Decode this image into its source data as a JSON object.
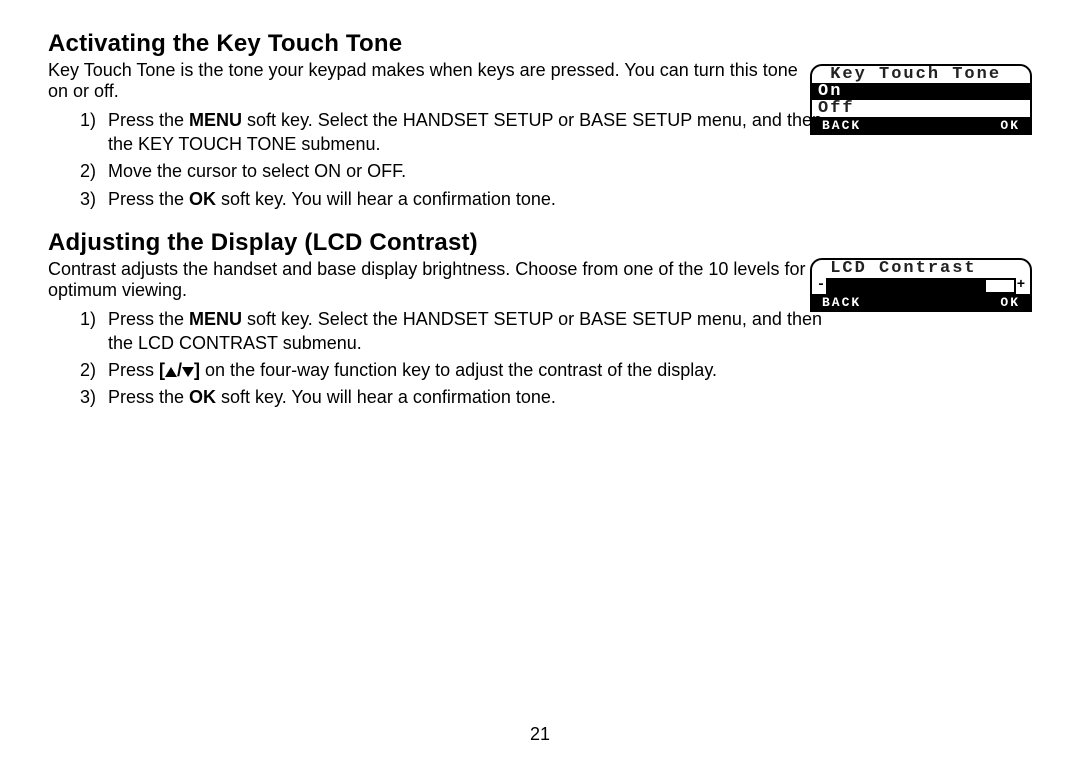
{
  "page_number": "21",
  "section1": {
    "heading": "Activating the Key Touch Tone",
    "intro": "Key Touch Tone is the tone your keypad makes when keys are pressed. You can turn this tone on or off.",
    "steps": {
      "s1a": "Press the ",
      "s1b": "MENU",
      "s1c": " soft key. Select the HANDSET SETUP or BASE SETUP menu, and then the KEY TOUCH TONE submenu.",
      "s2": "Move the cursor to select ON or OFF.",
      "s3a": "Press the ",
      "s3b": "OK",
      "s3c": " soft key. You will hear a confirmation tone."
    },
    "lcd": {
      "title": " Key Touch Tone",
      "option_on": "On",
      "option_off": "Off",
      "sk_back": "BACK",
      "sk_ok": "OK"
    }
  },
  "section2": {
    "heading": "Adjusting the Display (LCD Contrast)",
    "intro": "Contrast adjusts the handset and base display brightness. Choose from one of the 10 levels for optimum viewing.",
    "steps": {
      "s1a": "Press the ",
      "s1b": "MENU",
      "s1c": " soft key. Select the HANDSET SETUP or BASE SETUP menu, and then the LCD CONTRAST submenu.",
      "s2a": "Press ",
      "s2b": "[",
      "s2c": "/",
      "s2d": "]",
      "s2e": " on the four-way function key to adjust the contrast of the display.",
      "s3a": "Press the ",
      "s3b": "OK",
      "s3c": " soft key. You will hear a confirmation tone."
    },
    "lcd": {
      "title": " LCD Contrast",
      "minus": "-",
      "plus": "+",
      "fill_percent": 85,
      "sk_back": "BACK",
      "sk_ok": "OK"
    }
  }
}
